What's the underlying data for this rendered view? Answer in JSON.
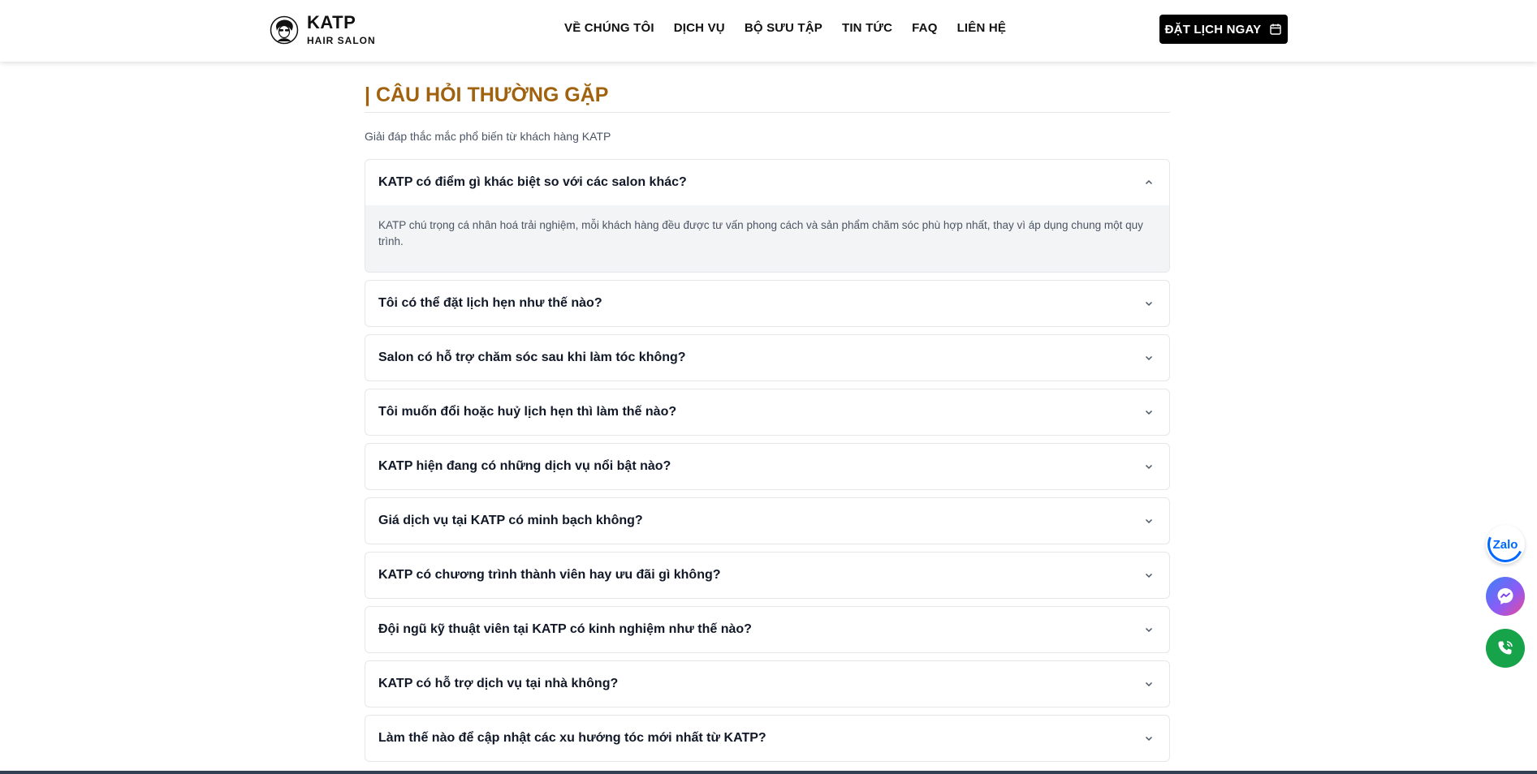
{
  "brand": {
    "name": "KATP",
    "tagline": "HAIR SALON"
  },
  "nav": {
    "items": [
      "VỀ CHÚNG TÔI",
      "DỊCH VỤ",
      "BỘ SƯU TẬP",
      "TIN TỨC",
      "FAQ",
      "LIÊN HỆ"
    ]
  },
  "cta": {
    "label": "ĐẶT LỊCH NGAY",
    "icon": "calendar-icon"
  },
  "section": {
    "title": "| CÂU HỎI THƯỜNG GẶP",
    "subtitle": "Giải đáp thắc mắc phổ biến từ khách hàng KATP"
  },
  "faqs": [
    {
      "question": "KATP có điểm gì khác biệt so với các salon khác?",
      "answer": "KATP chú trọng cá nhân hoá trải nghiệm, mỗi khách hàng đều được tư vấn phong cách và sản phẩm chăm sóc phù hợp nhất, thay vì áp dụng chung một quy trình.",
      "expanded": true
    },
    {
      "question": "Tôi có thể đặt lịch hẹn như thế nào?",
      "expanded": false
    },
    {
      "question": "Salon có hỗ trợ chăm sóc sau khi làm tóc không?",
      "expanded": false
    },
    {
      "question": "Tôi muốn đổi hoặc huỷ lịch hẹn thì làm thế nào?",
      "expanded": false
    },
    {
      "question": "KATP hiện đang có những dịch vụ nổi bật nào?",
      "expanded": false
    },
    {
      "question": "Giá dịch vụ tại KATP có minh bạch không?",
      "expanded": false
    },
    {
      "question": "KATP có chương trình thành viên hay ưu đãi gì không?",
      "expanded": false
    },
    {
      "question": "Đội ngũ kỹ thuật viên tại KATP có kinh nghiệm như thế nào?",
      "expanded": false
    },
    {
      "question": "KATP có hỗ trợ dịch vụ tại nhà không?",
      "expanded": false
    },
    {
      "question": "Làm thế nào để cập nhật các xu hướng tóc mới nhất từ KATP?",
      "expanded": false
    }
  ],
  "floating": {
    "zalo_label": "Zalo",
    "icons": [
      "zalo-icon",
      "messenger-icon",
      "phone-icon"
    ]
  },
  "colors": {
    "accent": "#a0620e",
    "cta_bg": "#000000",
    "zalo": "#0068ff",
    "phone": "#16a34a"
  }
}
